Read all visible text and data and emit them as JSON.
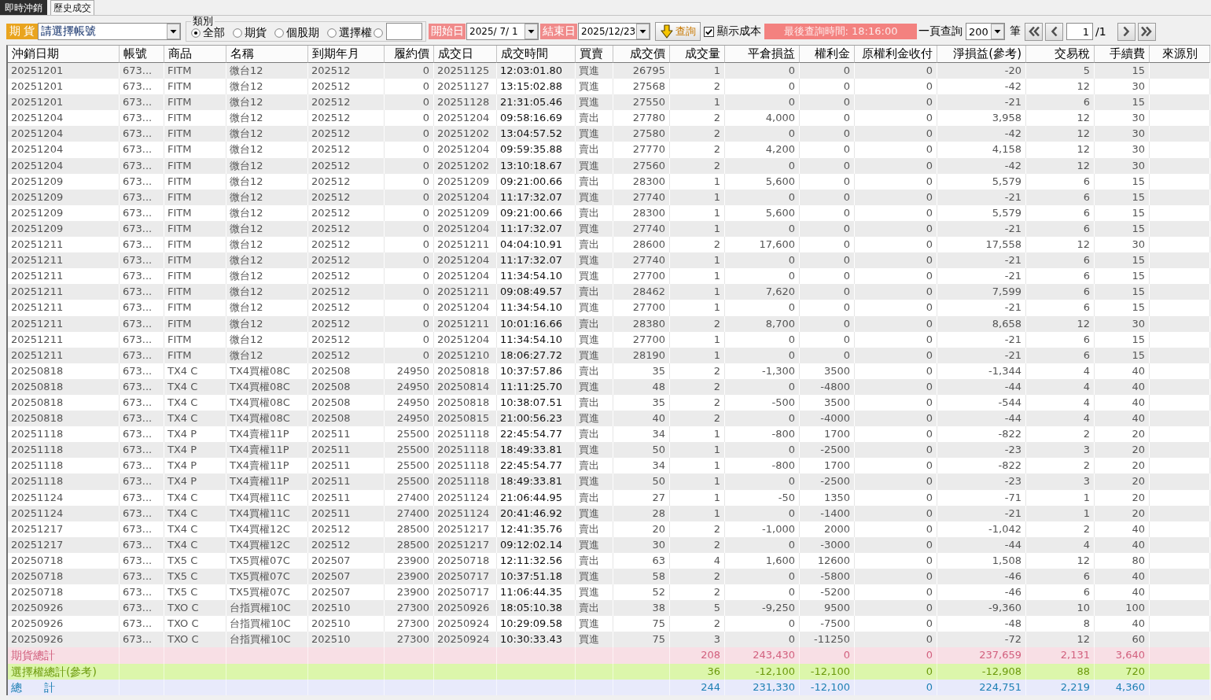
{
  "tabs": [
    {
      "label": "即時沖銷",
      "selected": true
    },
    {
      "label": "歷史成交",
      "selected": false
    }
  ],
  "toolbar": {
    "market_label": "期 貨",
    "account": "請選擇帳號",
    "category_group": {
      "title": "類別",
      "options": [
        {
          "kind": "radio",
          "label": "全部",
          "selected": true
        },
        {
          "kind": "radio",
          "label": "期貨",
          "selected": false
        },
        {
          "kind": "radio",
          "label": "個股期",
          "selected": false
        },
        {
          "kind": "radio",
          "label": "選擇權",
          "selected": false
        },
        {
          "kind": "custom",
          "selected": false
        }
      ]
    },
    "start_label": "開始日",
    "start_date": "2025/ 7/ 1",
    "end_label": "結束日",
    "end_date": "2025/12/23",
    "query_button": "查詢",
    "show_cost": {
      "label": "顯示成本",
      "checked": true
    },
    "last_query": "最後查詢時間: 18:16:00",
    "page_size_label": "一頁查詢",
    "page_size": "200",
    "page_size_unit": "筆",
    "page": "1",
    "page_total": "/1"
  },
  "table": {
    "columns": [
      "沖銷日期",
      "帳號",
      "商品",
      "名稱",
      "到期年月",
      "履約價",
      "成交日",
      "成交時間",
      "買賣",
      "成交價",
      "成交量",
      "平倉損益",
      "權利金",
      "原權利金收付",
      "淨損益(參考)",
      "交易稅",
      "手續費",
      "來源別"
    ],
    "rows": [
      [
        "20251201",
        "673...",
        "FITM",
        "微台12",
        "202512",
        "0",
        "20251125",
        "12:03:01.80",
        "買進",
        "26795",
        "1",
        "0",
        "0",
        "0",
        "-20",
        "5",
        "15"
      ],
      [
        "20251201",
        "673...",
        "FITM",
        "微台12",
        "202512",
        "0",
        "20251127",
        "13:15:02.88",
        "買進",
        "27568",
        "2",
        "0",
        "0",
        "0",
        "-42",
        "12",
        "30"
      ],
      [
        "20251201",
        "673...",
        "FITM",
        "微台12",
        "202512",
        "0",
        "20251128",
        "21:31:05.46",
        "買進",
        "27550",
        "1",
        "0",
        "0",
        "0",
        "-21",
        "6",
        "15"
      ],
      [
        "20251204",
        "673...",
        "FITM",
        "微台12",
        "202512",
        "0",
        "20251204",
        "09:58:16.69",
        "賣出",
        "27780",
        "2",
        "4,000",
        "0",
        "0",
        "3,958",
        "12",
        "30"
      ],
      [
        "20251204",
        "673...",
        "FITM",
        "微台12",
        "202512",
        "0",
        "20251202",
        "13:04:57.52",
        "買進",
        "27580",
        "2",
        "0",
        "0",
        "0",
        "-42",
        "12",
        "30"
      ],
      [
        "20251204",
        "673...",
        "FITM",
        "微台12",
        "202512",
        "0",
        "20251204",
        "09:59:35.88",
        "賣出",
        "27770",
        "2",
        "4,200",
        "0",
        "0",
        "4,158",
        "12",
        "30"
      ],
      [
        "20251204",
        "673...",
        "FITM",
        "微台12",
        "202512",
        "0",
        "20251202",
        "13:10:18.67",
        "買進",
        "27560",
        "2",
        "0",
        "0",
        "0",
        "-42",
        "12",
        "30"
      ],
      [
        "20251209",
        "673...",
        "FITM",
        "微台12",
        "202512",
        "0",
        "20251209",
        "09:21:00.66",
        "賣出",
        "28300",
        "1",
        "5,600",
        "0",
        "0",
        "5,579",
        "6",
        "15"
      ],
      [
        "20251209",
        "673...",
        "FITM",
        "微台12",
        "202512",
        "0",
        "20251204",
        "11:17:32.07",
        "買進",
        "27740",
        "1",
        "0",
        "0",
        "0",
        "-21",
        "6",
        "15"
      ],
      [
        "20251209",
        "673...",
        "FITM",
        "微台12",
        "202512",
        "0",
        "20251209",
        "09:21:00.66",
        "賣出",
        "28300",
        "1",
        "5,600",
        "0",
        "0",
        "5,579",
        "6",
        "15"
      ],
      [
        "20251209",
        "673...",
        "FITM",
        "微台12",
        "202512",
        "0",
        "20251204",
        "11:17:32.07",
        "買進",
        "27740",
        "1",
        "0",
        "0",
        "0",
        "-21",
        "6",
        "15"
      ],
      [
        "20251211",
        "673...",
        "FITM",
        "微台12",
        "202512",
        "0",
        "20251211",
        "04:04:10.91",
        "賣出",
        "28600",
        "2",
        "17,600",
        "0",
        "0",
        "17,558",
        "12",
        "30"
      ],
      [
        "20251211",
        "673...",
        "FITM",
        "微台12",
        "202512",
        "0",
        "20251204",
        "11:17:32.07",
        "買進",
        "27740",
        "1",
        "0",
        "0",
        "0",
        "-21",
        "6",
        "15"
      ],
      [
        "20251211",
        "673...",
        "FITM",
        "微台12",
        "202512",
        "0",
        "20251204",
        "11:34:54.10",
        "買進",
        "27700",
        "1",
        "0",
        "0",
        "0",
        "-21",
        "6",
        "15"
      ],
      [
        "20251211",
        "673...",
        "FITM",
        "微台12",
        "202512",
        "0",
        "20251211",
        "09:08:49.57",
        "賣出",
        "28462",
        "1",
        "7,620",
        "0",
        "0",
        "7,599",
        "6",
        "15"
      ],
      [
        "20251211",
        "673...",
        "FITM",
        "微台12",
        "202512",
        "0",
        "20251204",
        "11:34:54.10",
        "買進",
        "27700",
        "1",
        "0",
        "0",
        "0",
        "-21",
        "6",
        "15"
      ],
      [
        "20251211",
        "673...",
        "FITM",
        "微台12",
        "202512",
        "0",
        "20251211",
        "10:01:16.66",
        "賣出",
        "28380",
        "2",
        "8,700",
        "0",
        "0",
        "8,658",
        "12",
        "30"
      ],
      [
        "20251211",
        "673...",
        "FITM",
        "微台12",
        "202512",
        "0",
        "20251204",
        "11:34:54.10",
        "買進",
        "27700",
        "1",
        "0",
        "0",
        "0",
        "-21",
        "6",
        "15"
      ],
      [
        "20251211",
        "673...",
        "FITM",
        "微台12",
        "202512",
        "0",
        "20251210",
        "18:06:27.72",
        "買進",
        "28190",
        "1",
        "0",
        "0",
        "0",
        "-21",
        "6",
        "15"
      ],
      [
        "20250818",
        "673...",
        "TX4 C",
        "TX4買權08C",
        "202508",
        "24950",
        "20250818",
        "10:37:57.86",
        "賣出",
        "35",
        "2",
        "-1,300",
        "3500",
        "0",
        "-1,344",
        "4",
        "40"
      ],
      [
        "20250818",
        "673...",
        "TX4 C",
        "TX4買權08C",
        "202508",
        "24950",
        "20250814",
        "11:11:25.70",
        "買進",
        "48",
        "2",
        "0",
        "-4800",
        "0",
        "-44",
        "4",
        "40"
      ],
      [
        "20250818",
        "673...",
        "TX4 C",
        "TX4買權08C",
        "202508",
        "24950",
        "20250818",
        "10:38:07.51",
        "賣出",
        "35",
        "2",
        "-500",
        "3500",
        "0",
        "-544",
        "4",
        "40"
      ],
      [
        "20250818",
        "673...",
        "TX4 C",
        "TX4買權08C",
        "202508",
        "24950",
        "20250815",
        "21:00:56.23",
        "買進",
        "40",
        "2",
        "0",
        "-4000",
        "0",
        "-44",
        "4",
        "40"
      ],
      [
        "20251118",
        "673...",
        "TX4 P",
        "TX4賣權11P",
        "202511",
        "25500",
        "20251118",
        "22:45:54.77",
        "賣出",
        "34",
        "1",
        "-800",
        "1700",
        "0",
        "-822",
        "2",
        "20"
      ],
      [
        "20251118",
        "673...",
        "TX4 P",
        "TX4賣權11P",
        "202511",
        "25500",
        "20251118",
        "18:49:33.81",
        "買進",
        "50",
        "1",
        "0",
        "-2500",
        "0",
        "-23",
        "3",
        "20"
      ],
      [
        "20251118",
        "673...",
        "TX4 P",
        "TX4賣權11P",
        "202511",
        "25500",
        "20251118",
        "22:45:54.77",
        "賣出",
        "34",
        "1",
        "-800",
        "1700",
        "0",
        "-822",
        "2",
        "20"
      ],
      [
        "20251118",
        "673...",
        "TX4 P",
        "TX4賣權11P",
        "202511",
        "25500",
        "20251118",
        "18:49:33.81",
        "買進",
        "50",
        "1",
        "0",
        "-2500",
        "0",
        "-23",
        "3",
        "20"
      ],
      [
        "20251124",
        "673...",
        "TX4 C",
        "TX4買權11C",
        "202511",
        "27400",
        "20251124",
        "21:06:44.95",
        "賣出",
        "27",
        "1",
        "-50",
        "1350",
        "0",
        "-71",
        "1",
        "20"
      ],
      [
        "20251124",
        "673...",
        "TX4 C",
        "TX4買權11C",
        "202511",
        "27400",
        "20251124",
        "20:41:46.92",
        "買進",
        "28",
        "1",
        "0",
        "-1400",
        "0",
        "-21",
        "1",
        "20"
      ],
      [
        "20251217",
        "673...",
        "TX4 C",
        "TX4買權12C",
        "202512",
        "28500",
        "20251217",
        "12:41:35.76",
        "賣出",
        "20",
        "2",
        "-1,000",
        "2000",
        "0",
        "-1,042",
        "2",
        "40"
      ],
      [
        "20251217",
        "673...",
        "TX4 C",
        "TX4買權12C",
        "202512",
        "28500",
        "20251217",
        "09:12:02.14",
        "買進",
        "30",
        "2",
        "0",
        "-3000",
        "0",
        "-44",
        "4",
        "40"
      ],
      [
        "20250718",
        "673...",
        "TX5 C",
        "TX5買權07C",
        "202507",
        "23900",
        "20250718",
        "12:11:32.56",
        "賣出",
        "63",
        "4",
        "1,600",
        "12600",
        "0",
        "1,508",
        "12",
        "80"
      ],
      [
        "20250718",
        "673...",
        "TX5 C",
        "TX5買權07C",
        "202507",
        "23900",
        "20250717",
        "10:37:51.18",
        "買進",
        "58",
        "2",
        "0",
        "-5800",
        "0",
        "-46",
        "6",
        "40"
      ],
      [
        "20250718",
        "673...",
        "TX5 C",
        "TX5買權07C",
        "202507",
        "23900",
        "20250717",
        "11:06:44.35",
        "買進",
        "52",
        "2",
        "0",
        "-5200",
        "0",
        "-46",
        "6",
        "40"
      ],
      [
        "20250926",
        "673...",
        "TXO C",
        "台指買權10C",
        "202510",
        "27300",
        "20250926",
        "18:05:10.38",
        "賣出",
        "38",
        "5",
        "-9,250",
        "9500",
        "0",
        "-9,360",
        "10",
        "100"
      ],
      [
        "20250926",
        "673...",
        "TXO C",
        "台指買權10C",
        "202510",
        "27300",
        "20250924",
        "10:29:09.58",
        "買進",
        "75",
        "2",
        "0",
        "-7500",
        "0",
        "-48",
        "8",
        "40"
      ],
      [
        "20250926",
        "673...",
        "TXO C",
        "台指買權10C",
        "202510",
        "27300",
        "20250924",
        "10:30:33.43",
        "買進",
        "75",
        "3",
        "0",
        "-11250",
        "0",
        "-72",
        "12",
        "60"
      ]
    ],
    "totals": [
      {
        "kind": "futures",
        "label": "期貨總計",
        "values": [
          "208",
          "243,430",
          "0",
          "0",
          "237,659",
          "2,131",
          "3,640"
        ]
      },
      {
        "kind": "options",
        "label": "選擇權總計(參考)",
        "values": [
          "36",
          "-12,100",
          "-12,100",
          "0",
          "-12,908",
          "88",
          "720"
        ]
      },
      {
        "kind": "grand",
        "label": "總　　計",
        "values": [
          "244",
          "231,330",
          "-12,100",
          "0",
          "224,751",
          "2,219",
          "4,360"
        ]
      }
    ]
  }
}
